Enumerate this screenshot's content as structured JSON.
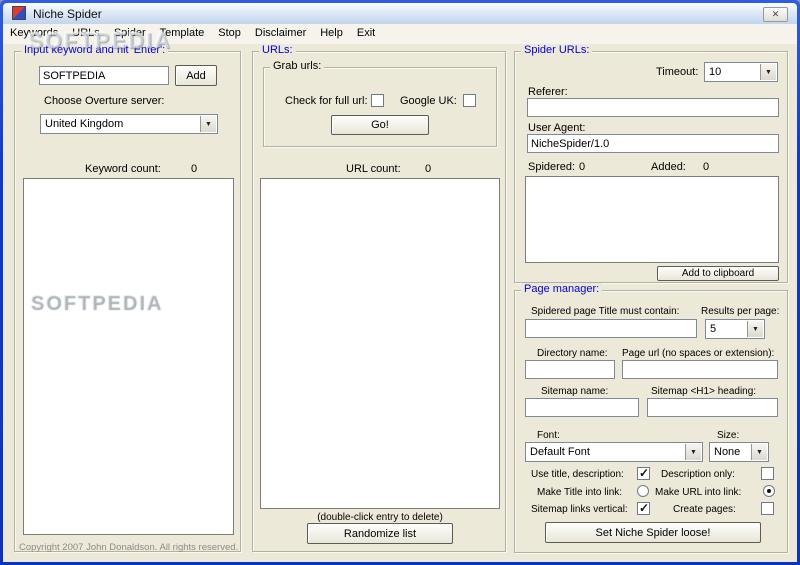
{
  "window": {
    "title": "Niche Spider"
  },
  "icons": {
    "dropdown_arrow": "▼",
    "close": "✕"
  },
  "menu": {
    "items": [
      "Keywords",
      "URLs",
      "Spider",
      "Template",
      "Stop",
      "Disclaimer",
      "Help",
      "Exit"
    ]
  },
  "watermark": "SOFTPEDIA",
  "keywords": {
    "group_title": "Input keyword and hit 'Enter':",
    "input_value": "SOFTPEDIA",
    "add_button": "Add",
    "server_label": "Choose Overture server:",
    "server_selected": "United Kingdom",
    "count_label": "Keyword count:",
    "count_value": "0",
    "copyright": "Copyright 2007 John Donaldson. All rights reserved."
  },
  "urls": {
    "group_title": "URLs:",
    "grab_group_title": "Grab urls:",
    "check_full_label": "Check for full url:",
    "check_full_checked": "false",
    "google_uk_label": "Google UK:",
    "google_uk_checked": "false",
    "go_button": "Go!",
    "count_label": "URL count:",
    "count_value": "0",
    "hint": "(double-click entry to delete)",
    "randomize_button": "Randomize list"
  },
  "spider": {
    "group_title": "Spider URLs:",
    "timeout_label": "Timeout:",
    "timeout_value": "10",
    "referer_label": "Referer:",
    "referer_value": "",
    "user_agent_label": "User Agent:",
    "user_agent_value": "NicheSpider/1.0",
    "spidered_label": "Spidered:",
    "spidered_value": "0",
    "added_label": "Added:",
    "added_value": "0",
    "clipboard_button": "Add to clipboard"
  },
  "page_manager": {
    "group_title": "Page manager:",
    "title_contain_label": "Spidered page Title must contain:",
    "title_contain_value": "",
    "results_label": "Results per page:",
    "results_value": "5",
    "directory_label": "Directory name:",
    "directory_value": "",
    "page_url_label": "Page url (no spaces or extension):",
    "page_url_value": "",
    "sitemap_name_label": "Sitemap name:",
    "sitemap_name_value": "",
    "sitemap_h1_label": "Sitemap <H1> heading:",
    "sitemap_h1_value": "",
    "font_label": "Font:",
    "font_value": "Default Font",
    "size_label": "Size:",
    "size_value": "None",
    "use_title_label": "Use title, description:",
    "use_title_checked": "true",
    "desc_only_label": "Description only:",
    "desc_only_checked": "false",
    "title_link_label": "Make Title into link:",
    "title_link_checked": "false",
    "url_link_label": "Make URL into link:",
    "url_link_checked": "true",
    "vertical_label": "Sitemap links vertical:",
    "vertical_checked": "true",
    "create_pages_label": "Create pages:",
    "create_pages_checked": "false",
    "loose_button": "Set Niche Spider loose!"
  }
}
